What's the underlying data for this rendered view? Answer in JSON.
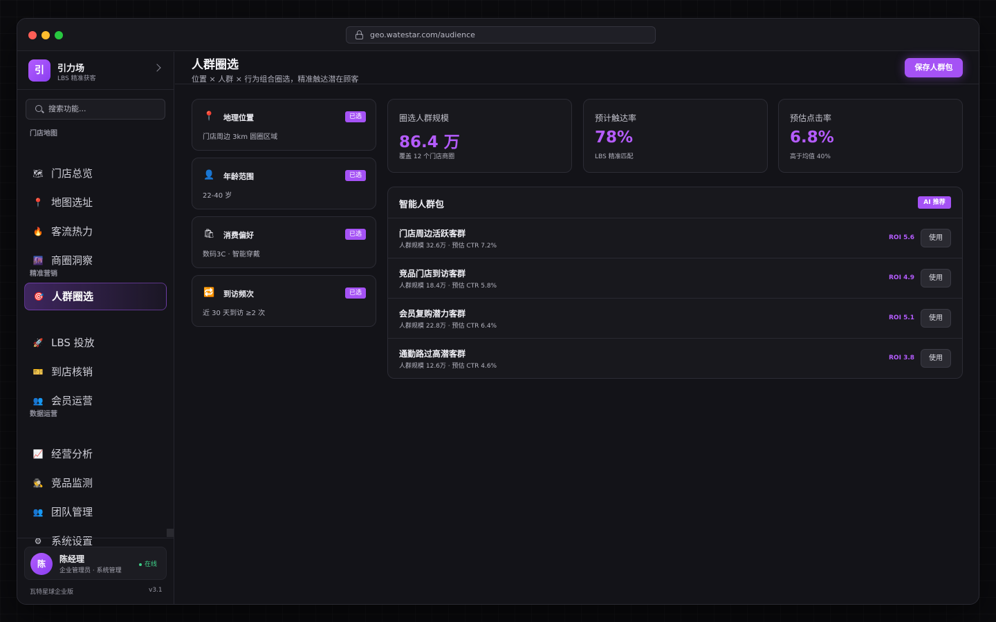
{
  "browser": {
    "url": "geo.watestar.com/audience"
  },
  "brand": {
    "logo": "引",
    "name": "引力场",
    "subtitle": "LBS 精准获客"
  },
  "search": {
    "placeholder": "搜索功能..."
  },
  "nav": {
    "sections": [
      {
        "label": "门店地图",
        "items": [
          {
            "label": "门店总览",
            "icon": "🗺"
          },
          {
            "label": "地图选址",
            "icon": "📍"
          },
          {
            "label": "客流热力",
            "icon": "🔥"
          },
          {
            "label": "商圈洞察",
            "icon": "🌆"
          }
        ]
      },
      {
        "label": "精准营销",
        "items": [
          {
            "label": "人群圈选",
            "icon": "🎯",
            "active": true
          },
          {
            "label": "LBS 投放",
            "icon": "🚀"
          },
          {
            "label": "到店核销",
            "icon": "🎫"
          },
          {
            "label": "会员运营",
            "icon": "👥"
          }
        ]
      },
      {
        "label": "数据运营",
        "items": [
          {
            "label": "经营分析",
            "icon": "📈"
          },
          {
            "label": "竞品监测",
            "icon": "🕵"
          },
          {
            "label": "团队管理",
            "icon": "👥"
          },
          {
            "label": "系统设置",
            "icon": "⚙"
          }
        ]
      }
    ]
  },
  "user": {
    "avatar": "陈",
    "name": "陈经理",
    "role": "企业管理员 · 系统管理",
    "status": "在线"
  },
  "footer": {
    "edition": "瓦特星球企业版",
    "version": "v3.1"
  },
  "page": {
    "title": "人群圈选",
    "subtitle": "位置 × 人群 × 行为组合圈选，精准触达潜在顾客",
    "save_label": "保存人群包"
  },
  "filters": [
    {
      "icon": "📍",
      "name": "地理位置",
      "tag": "已选",
      "value": "门店周边 3km 圆圈区域"
    },
    {
      "icon": "👤",
      "name": "年龄范围",
      "tag": "已选",
      "value": "22-40 岁"
    },
    {
      "icon": "🛍",
      "name": "消费偏好",
      "tag": "已选",
      "value": "数码3C · 智能穿戴"
    },
    {
      "icon": "🔁",
      "name": "到访频次",
      "tag": "已选",
      "value": "近 30 天到访 ≥2 次"
    }
  ],
  "stats": [
    {
      "label": "圈选人群规模",
      "value": "86.4 万",
      "note": "覆盖 12 个门店商圈"
    },
    {
      "label": "预计触达率",
      "value": "78%",
      "note": "LBS 精准匹配"
    },
    {
      "label": "预估点击率",
      "value": "6.8%",
      "note": "高于均值 40%"
    }
  ],
  "packages": {
    "title": "智能人群包",
    "badge": "AI 推荐",
    "use_label": "使用",
    "items": [
      {
        "name": "门店周边活跃客群",
        "meta": "人群规模 32.6万 · 预估 CTR 7.2%",
        "roi": "ROI 5.6"
      },
      {
        "name": "竞品门店到访客群",
        "meta": "人群规模 18.4万 · 预估 CTR 5.8%",
        "roi": "ROI 4.9"
      },
      {
        "name": "会员复购潜力客群",
        "meta": "人群规模 22.8万 · 预估 CTR 6.4%",
        "roi": "ROI 5.1"
      },
      {
        "name": "通勤路过高潜客群",
        "meta": "人群规模 12.6万 · 预估 CTR 4.6%",
        "roi": "ROI 3.8"
      }
    ]
  },
  "colors": {
    "accent": "#a552f5",
    "accent_text": "#b55cff",
    "online": "#3fd38a"
  }
}
